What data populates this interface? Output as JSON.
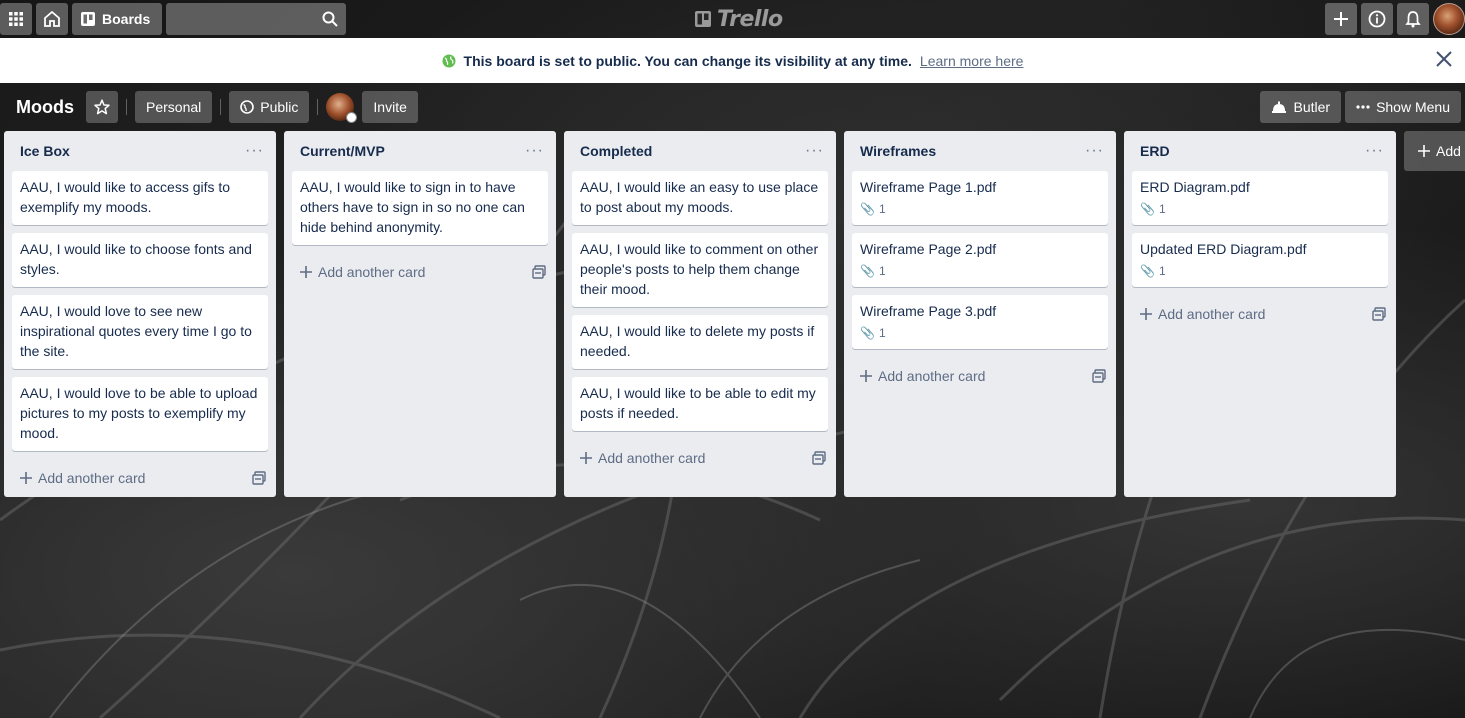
{
  "header": {
    "boards_label": "Boards",
    "search_placeholder": "",
    "logo_text": "Trello"
  },
  "notice": {
    "message": "This board is set to public. You can change its visibility at any time.",
    "link": "Learn more here"
  },
  "board": {
    "title": "Moods",
    "team_label": "Personal",
    "visibility_label": "Public",
    "invite_label": "Invite",
    "butler_label": "Butler",
    "menu_label": "Show Menu"
  },
  "lists": [
    {
      "title": "Ice Box",
      "add_label": "Add another card",
      "cards": [
        {
          "text": "AAU, I would like to access gifs to exemplify my moods."
        },
        {
          "text": "AAU, I would like to choose fonts and styles."
        },
        {
          "text": "AAU, I would love to see new inspirational quotes every time I go to the site."
        },
        {
          "text": "AAU, I would love to be able to upload pictures to my posts to exemplify my mood."
        }
      ]
    },
    {
      "title": "Current/MVP",
      "add_label": "Add another card",
      "cards": [
        {
          "text": "AAU, I would like to sign in to have others have to sign in so no one can hide behind anonymity."
        }
      ]
    },
    {
      "title": "Completed",
      "add_label": "Add another card",
      "cards": [
        {
          "text": "AAU, I would like an easy to use place to post about my moods."
        },
        {
          "text": "AAU, I would like to comment on other people's posts to help them change their mood."
        },
        {
          "text": "AAU, I would like to delete my posts if needed."
        },
        {
          "text": "AAU, I would like to be able to edit my posts if needed."
        }
      ]
    },
    {
      "title": "Wireframes",
      "add_label": "Add another card",
      "cards": [
        {
          "text": "Wireframe Page 1.pdf",
          "attachments": "1"
        },
        {
          "text": "Wireframe Page 2.pdf",
          "attachments": "1"
        },
        {
          "text": "Wireframe Page 3.pdf",
          "attachments": "1"
        }
      ]
    },
    {
      "title": "ERD",
      "add_label": "Add another card",
      "cards": [
        {
          "text": "ERD Diagram.pdf",
          "attachments": "1"
        },
        {
          "text": "Updated ERD Diagram.pdf",
          "attachments": "1"
        }
      ]
    }
  ],
  "add_list_label": "Add",
  "colors": {
    "list_bg": "#ebecf0",
    "text": "#172b4d",
    "muted": "#5e6c84",
    "public_green": "#61bd4f"
  }
}
